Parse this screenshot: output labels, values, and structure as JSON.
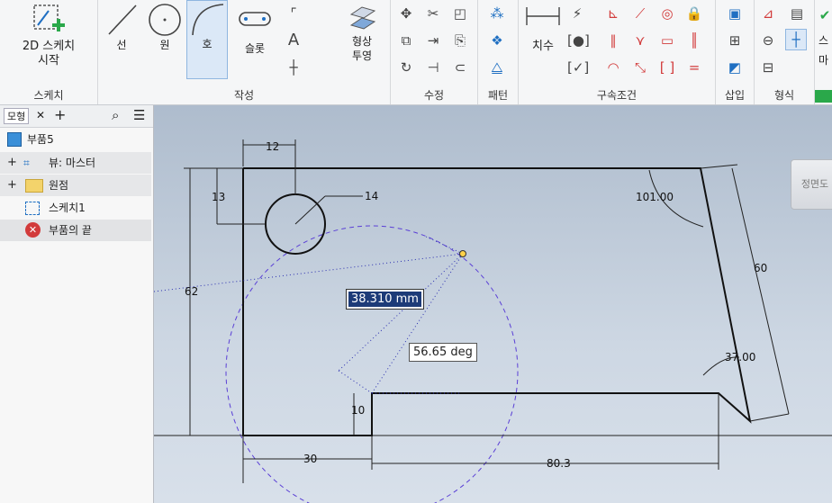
{
  "ribbon": {
    "sketch_panel": {
      "start_label": "2D 스케치\n시작",
      "title": "스케치"
    },
    "create_panel": {
      "line": "선",
      "circle": "원",
      "arc": "호",
      "slot": "슬롯",
      "text_icon": "A",
      "project": "형상\n투영",
      "title": "작성"
    },
    "modify_panel": {
      "title": "수정"
    },
    "pattern_panel": {
      "title": "패턴"
    },
    "constrain_panel": {
      "dimension": "치수",
      "title": "구속조건"
    },
    "insert_panel": {
      "title": "삽입"
    },
    "format_panel": {
      "title": "형식"
    },
    "extra_panel": {
      "label": "스\n마"
    }
  },
  "browser": {
    "tab_label": "모형",
    "close": "✕",
    "add": "+",
    "tree": [
      {
        "label": "부품5"
      },
      {
        "label": "뷰: 마스터"
      },
      {
        "label": "원점"
      },
      {
        "label": "스케치1"
      },
      {
        "label": "부품의 끝"
      }
    ]
  },
  "canvas": {
    "viewcube_label": "정면도",
    "length_input": "38.310 mm",
    "angle_input": "56.65 deg",
    "dimensions": {
      "top_offset": "12",
      "circle_v": "13",
      "circle_dia": "14",
      "height": "62",
      "angle_top": "101.00",
      "slant_len": "60",
      "angle_bottom": "37.00",
      "step_height": "10",
      "left_bottom": "30",
      "bottom_len": "80.3"
    }
  },
  "colors": {
    "accent": "#1f6fc2",
    "input_bg": "#1d3b78",
    "constraint_red": "#d23b3b",
    "preview": "#5a3fd6"
  }
}
